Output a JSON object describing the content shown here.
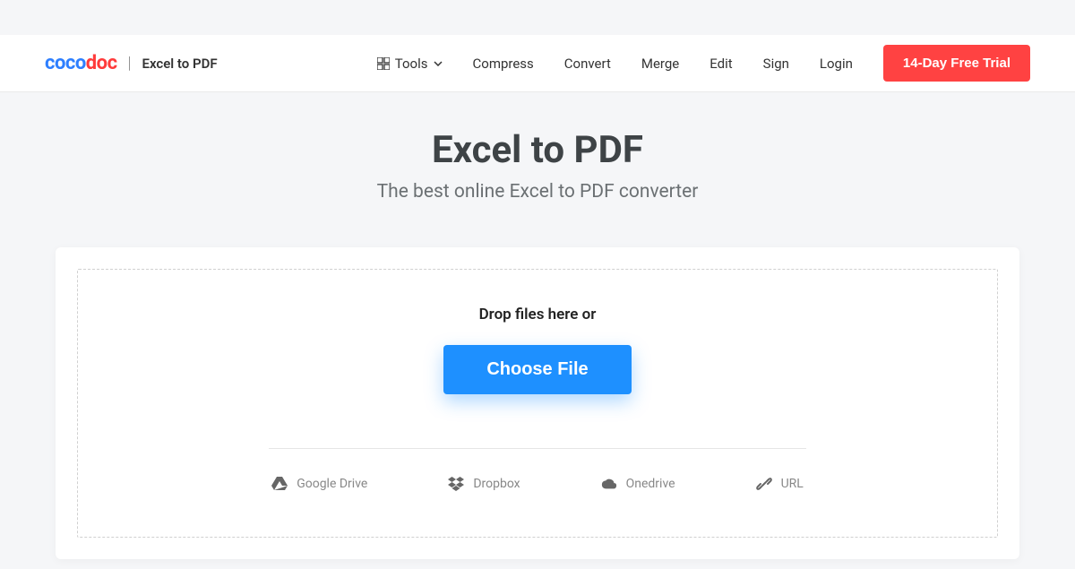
{
  "brand": {
    "part1": "coco",
    "part2": "doc"
  },
  "header": {
    "page_name": "Excel to PDF",
    "nav": {
      "tools": "Tools",
      "compress": "Compress",
      "convert": "Convert",
      "merge": "Merge",
      "edit": "Edit",
      "sign": "Sign",
      "login": "Login"
    },
    "trial_button": "14-Day Free Trial"
  },
  "hero": {
    "title": "Excel to PDF",
    "subtitle": "The best online Excel to PDF converter"
  },
  "dropzone": {
    "drop_text": "Drop files here or",
    "choose_button": "Choose File"
  },
  "sources": {
    "google_drive": "Google Drive",
    "dropbox": "Dropbox",
    "onedrive": "Onedrive",
    "url": "URL"
  },
  "colors": {
    "brand_blue": "#2e7fff",
    "brand_red": "#ff3b3b",
    "cta_red": "#ff4242",
    "cta_blue": "#1e90ff"
  }
}
